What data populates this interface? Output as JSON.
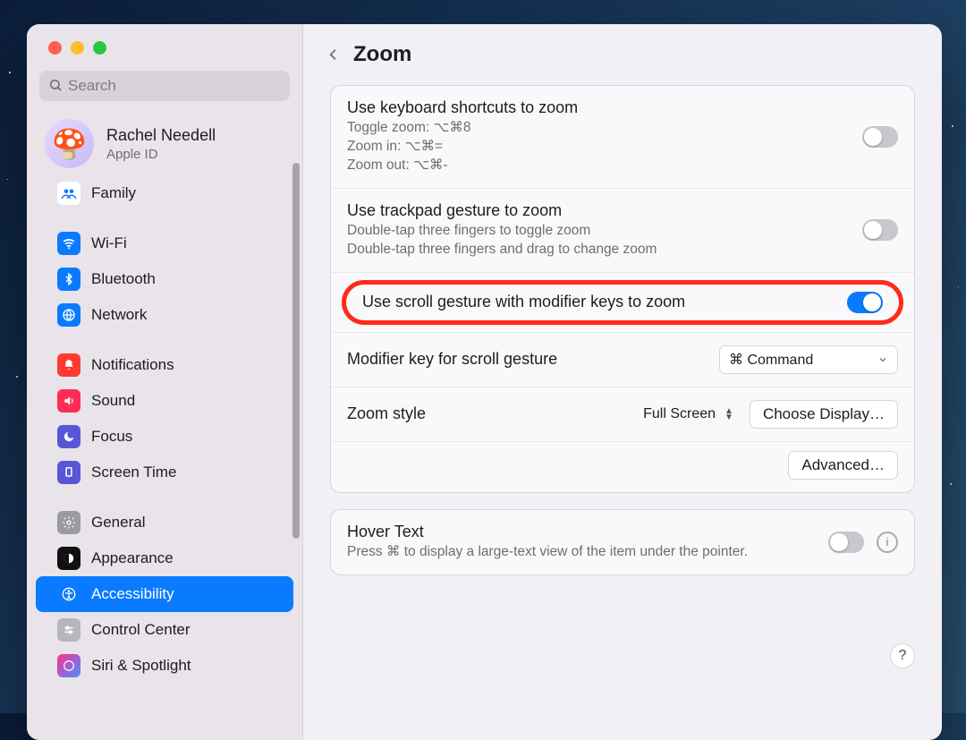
{
  "window": {
    "title": "Zoom",
    "search_placeholder": "Search"
  },
  "profile": {
    "name": "Rachel Needell",
    "sub": "Apple ID"
  },
  "sidebar": {
    "items": [
      {
        "id": "family",
        "label": "Family",
        "icon_bg": "#ffffff"
      },
      {
        "id": "wifi",
        "label": "Wi-Fi",
        "icon_bg": "#0a7aff"
      },
      {
        "id": "bluetooth",
        "label": "Bluetooth",
        "icon_bg": "#0a7aff"
      },
      {
        "id": "network",
        "label": "Network",
        "icon_bg": "#0a7aff"
      },
      {
        "id": "notifications",
        "label": "Notifications",
        "icon_bg": "#ff3b30"
      },
      {
        "id": "sound",
        "label": "Sound",
        "icon_bg": "#ff2d55"
      },
      {
        "id": "focus",
        "label": "Focus",
        "icon_bg": "#5856d6"
      },
      {
        "id": "screen-time",
        "label": "Screen Time",
        "icon_bg": "#5856d6"
      },
      {
        "id": "general",
        "label": "General",
        "icon_bg": "#9a9aa0"
      },
      {
        "id": "appearance",
        "label": "Appearance",
        "icon_bg": "#111111"
      },
      {
        "id": "accessibility",
        "label": "Accessibility",
        "icon_bg": "#0a7aff",
        "selected": true
      },
      {
        "id": "control-center",
        "label": "Control Center",
        "icon_bg": "#b6b6bc"
      },
      {
        "id": "siri",
        "label": "Siri & Spotlight",
        "icon_bg": "#333333"
      }
    ]
  },
  "zoom": {
    "kb": {
      "title": "Use keyboard shortcuts to zoom",
      "line1": "Toggle zoom: ⌥⌘8",
      "line2": "Zoom in: ⌥⌘=",
      "line3": "Zoom out: ⌥⌘-",
      "enabled": false
    },
    "trackpad": {
      "title": "Use trackpad gesture to zoom",
      "line1": "Double-tap three fingers to toggle zoom",
      "line2": "Double-tap three fingers and drag to change zoom",
      "enabled": false
    },
    "scroll": {
      "title": "Use scroll gesture with modifier keys to zoom",
      "enabled": true
    },
    "modifier": {
      "label": "Modifier key for scroll gesture",
      "value": "⌘ Command"
    },
    "style": {
      "label": "Zoom style",
      "value": "Full Screen",
      "choose_btn": "Choose Display…"
    },
    "advanced_btn": "Advanced…"
  },
  "hover": {
    "title": "Hover Text",
    "sub": "Press ⌘ to display a large-text view of the item under the pointer.",
    "enabled": false
  },
  "help": {
    "label": "?"
  }
}
